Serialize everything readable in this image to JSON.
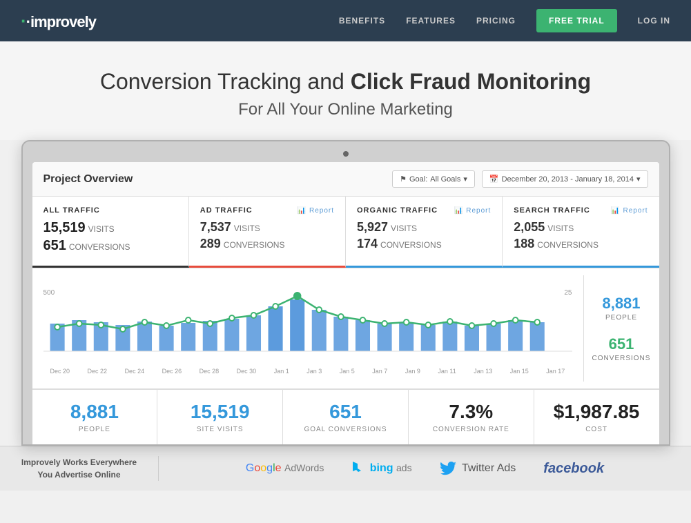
{
  "nav": {
    "logo": "·improvely",
    "links": [
      "BENEFITS",
      "FEATURES",
      "PRICING"
    ],
    "free_trial": "FREE TRIAL",
    "login": "LOG IN"
  },
  "hero": {
    "line1_normal": "Conversion Tracking and ",
    "line1_bold": "Click Fraud Monitoring",
    "line2": "For All Your Online Marketing"
  },
  "dashboard": {
    "title": "Project Overview",
    "goal_label": "Goal:",
    "goal_value": "All Goals",
    "date_range": "December 20, 2013 - January 18, 2014",
    "traffic": {
      "all": {
        "label": "ALL TRAFFIC",
        "visits_num": "15,519",
        "visits_text": "VISITS",
        "conversions_num": "651",
        "conversions_text": "CONVERSIONS"
      },
      "ad": {
        "label": "AD TRAFFIC",
        "report": "Report",
        "visits_num": "7,537",
        "visits_text": "VISITS",
        "conversions_num": "289",
        "conversions_text": "CONVERSIONS"
      },
      "organic": {
        "label": "ORGANIC TRAFFIC",
        "report": "Report",
        "visits_num": "5,927",
        "visits_text": "VISITS",
        "conversions_num": "174",
        "conversions_text": "CONVERSIONS"
      },
      "search": {
        "label": "SEARCH TRAFFIC",
        "report": "Report",
        "visits_num": "2,055",
        "visits_text": "VISITS",
        "conversions_num": "188",
        "conversions_text": "CONVERSIONS"
      }
    },
    "chart_y_left": "500",
    "chart_y_right": "25",
    "x_labels": [
      "Dec 20",
      "Dec 22",
      "Dec 24",
      "Dec 26",
      "Dec 28",
      "Dec 30",
      "Jan 1",
      "Jan 3",
      "Jan 5",
      "Jan 7",
      "Jan 9",
      "Jan 11",
      "Jan 13",
      "Jan 15",
      "Jan 17"
    ],
    "side_stats": {
      "people_num": "8,881",
      "people_label": "PEOPLE",
      "conversions_num": "651",
      "conversions_label": "CONVERSIONS"
    },
    "bottom": {
      "people": {
        "num": "8,881",
        "label": "PEOPLE"
      },
      "site_visits": {
        "num": "15,519",
        "label": "SITE VISITS"
      },
      "goal_conversions": {
        "num": "651",
        "label": "GOAL CONVERSIONS"
      },
      "conversion_rate": {
        "num": "7.3%",
        "label": "CONVERSION RATE"
      },
      "cost": {
        "num": "$1,987.85",
        "label": "COST"
      }
    }
  },
  "footer": {
    "tagline_line1": "Improvely Works Everywhere",
    "tagline_line2": "You Advertise Online",
    "partners": [
      "Google AdWords",
      "bing ads",
      "Twitter Ads",
      "facebook"
    ]
  }
}
